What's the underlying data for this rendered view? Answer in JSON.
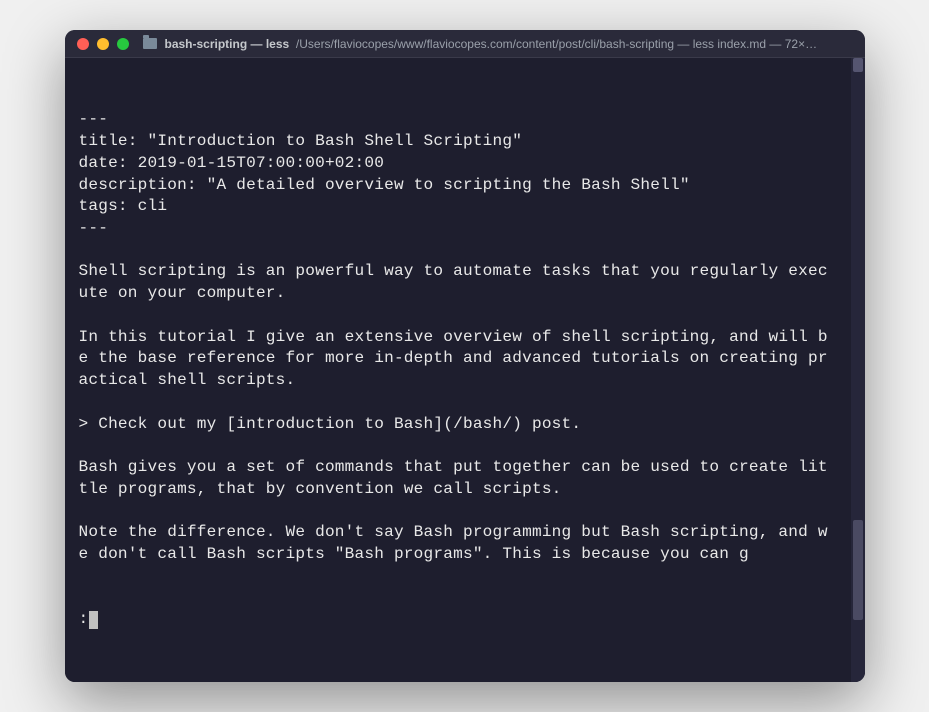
{
  "titlebar": {
    "process": "bash-scripting — less",
    "path": "/Users/flaviocopes/www/flaviocopes.com/content/post/cli/bash-scripting — less index.md — 72×…"
  },
  "content": {
    "lines": [
      "---",
      "title: \"Introduction to Bash Shell Scripting\"",
      "date: 2019-01-15T07:00:00+02:00",
      "description: \"A detailed overview to scripting the Bash Shell\"",
      "tags: cli",
      "---",
      "",
      "Shell scripting is an powerful way to automate tasks that you regularly execute on your computer.",
      "",
      "In this tutorial I give an extensive overview of shell scripting, and will be the base reference for more in-depth and advanced tutorials on creating practical shell scripts.",
      "",
      "> Check out my [introduction to Bash](/bash/) post.",
      "",
      "Bash gives you a set of commands that put together can be used to create little programs, that by convention we call scripts.",
      "",
      "Note the difference. We don't say Bash programming but Bash scripting, and we don't call Bash scripts \"Bash programs\". This is because you can g"
    ],
    "prompt": ":"
  }
}
